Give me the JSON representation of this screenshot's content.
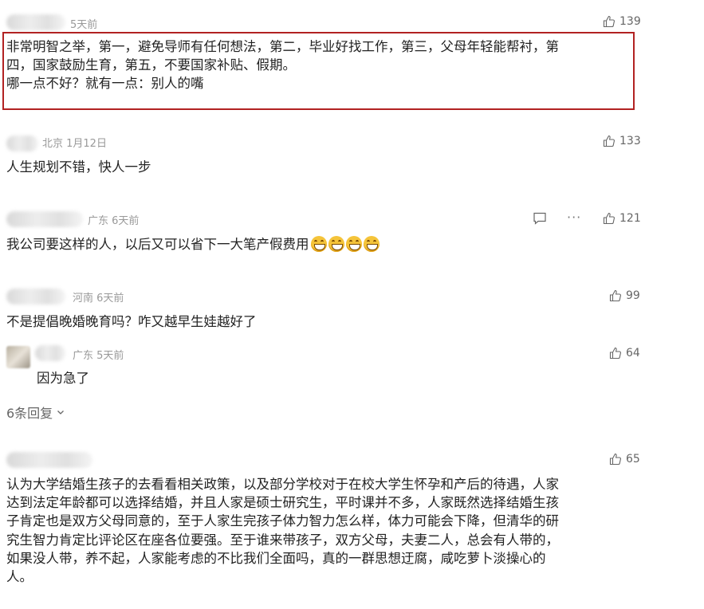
{
  "comments": [
    {
      "time": "5天前",
      "likes": "139",
      "lines": [
        "非常明智之举，第一，避免导师有任何想法，第二，毕业好找工作，第三，父母年轻能帮衬，第",
        "四，国家鼓励生育，第五，不要国家补贴、假期。",
        "哪一点不好？就有一点：别人的嘴"
      ]
    },
    {
      "location_time": "北京 1月12日",
      "likes": "133",
      "text": "人生规划不错，快人一步"
    },
    {
      "location_time": "广东 6天前",
      "likes": "121",
      "text": "我公司要这样的人，以后又可以省下一大笔产假费用",
      "emoji_count": 4,
      "emoji_icon": "grinning-face-icon"
    },
    {
      "location_time": "河南 6天前",
      "likes": "99",
      "text": "不是提倡晚婚晚育吗？咋又越早生娃越好了"
    },
    {
      "location_time": "广东 5天前",
      "likes": "64",
      "text": "因为急了"
    },
    {
      "likes": "65",
      "lines": [
        "认为大学结婚生孩子的去看看相关政策，以及部分学校对于在校大学生怀孕和产后的待遇，人家",
        "达到法定年龄都可以选择结婚，并且人家是硕士研究生，平时课并不多，人家既然选择结婚生孩",
        "子肯定也是双方父母同意的，至于人家生完孩子体力智力怎么样，体力可能会下降，但清华的研",
        "究生智力肯定比评论区在座各位要强。至于谁来带孩子，双方父母，夫妻二人，总会有人带的，",
        "如果没人带，养不起，人家能考虑的不比我们全面吗，真的一群思想迂腐，咸吃萝卜淡操心的",
        "人。"
      ]
    }
  ],
  "replies_toggle": "6条回复",
  "icons": {
    "like": "thumbs-up-icon",
    "reply": "comment-icon",
    "more": "more-dots-icon",
    "expand": "chevron-down-icon"
  },
  "colors": {
    "highlight_border": "#b22222",
    "meta_text": "#999999"
  }
}
